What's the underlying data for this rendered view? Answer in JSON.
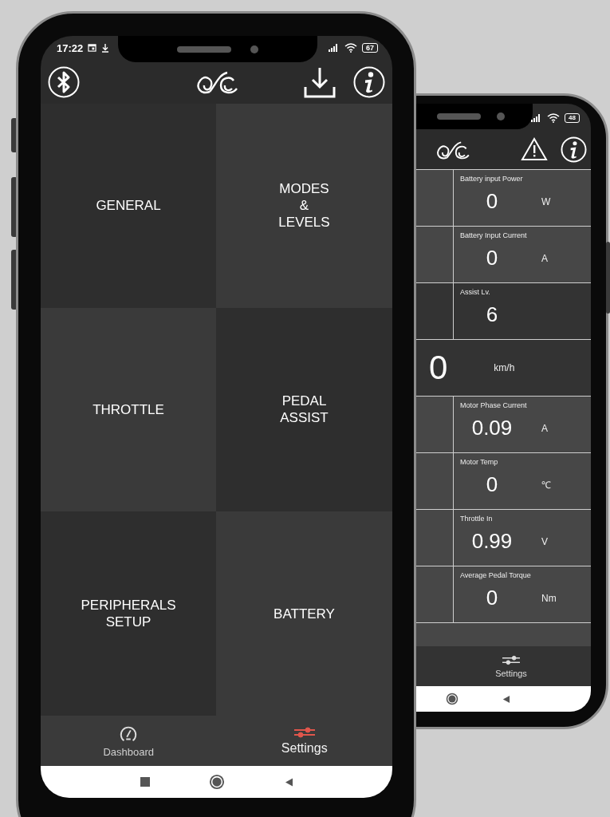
{
  "settings_phone": {
    "status_bar": {
      "time": "17:22",
      "battery": "67"
    },
    "tiles": [
      {
        "label": "GENERAL"
      },
      {
        "label": "MODES\n&\nLEVELS"
      },
      {
        "label": "THROTTLE"
      },
      {
        "label": "PEDAL\nASSIST"
      },
      {
        "label": "PERIPHERALS\nSETUP"
      },
      {
        "label": "BATTERY"
      }
    ],
    "nav": [
      {
        "label": "Dashboard",
        "selected": false
      },
      {
        "label": "Settings",
        "selected": true
      }
    ]
  },
  "dashboard_phone": {
    "status_bar": {
      "battery": "48"
    },
    "metrics": [
      {
        "kind": "metric",
        "label": "Battery input Power",
        "value": "0",
        "unit": "W"
      },
      {
        "kind": "metric",
        "label": "Battery Input Current",
        "value": "0",
        "unit": "A"
      },
      {
        "kind": "level",
        "label": "Assist Lv.",
        "value": "6"
      },
      {
        "kind": "speed",
        "value": "0",
        "unit": "km/h"
      },
      {
        "kind": "metric",
        "label": "Motor Phase Current",
        "value": "0.09",
        "unit": "A"
      },
      {
        "kind": "metric",
        "label": "Motor Temp",
        "value": "0",
        "unit": "℃"
      },
      {
        "kind": "metric",
        "label": "Throttle In",
        "value": "0.99",
        "unit": "V"
      },
      {
        "kind": "metric",
        "label": "Average Pedal Torque",
        "value": "0",
        "unit": "Nm"
      }
    ],
    "nav": [
      {
        "label": "Settings",
        "selected": false
      }
    ]
  }
}
